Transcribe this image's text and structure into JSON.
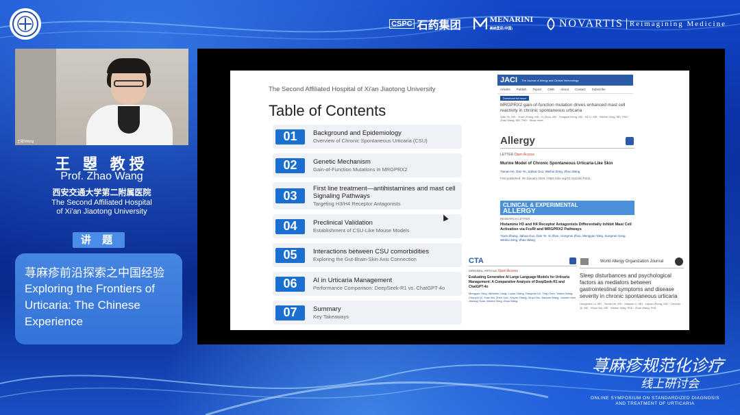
{
  "sponsors": {
    "cspc_mark": "CSPC",
    "cspc_name": "石药集团",
    "menarini": "MENARINI",
    "menarini_sub": "美纳里尼(中国)",
    "novartis": "NOVARTIS",
    "novartis_tagline": "Reimagining Medicine"
  },
  "speaker": {
    "name_cn": "王 曌 教授",
    "name_en": "Prof.  Zhao Wang",
    "hospital_cn": "西安交通大学第二附属医院",
    "hospital_en_line1": "The Second Affiliated Hospital",
    "hospital_en_line2": "of Xi'an Jiaotong University",
    "video_caption": "王曌/Wang"
  },
  "topic": {
    "badge": "讲 题",
    "title_cn": "荨麻疹前沿探索之中国经验",
    "title_en": "Exploring the Frontiers of Urticaria: The Chinese Experience"
  },
  "slide": {
    "hospital": "The Second Affiliated Hospital of Xi'an Jiaotong University",
    "title": "Table of Contents",
    "items": [
      {
        "num": "01",
        "head": "Background and Epidemiology",
        "sub": "Overview of Chronic Spontaneous Urticaria (CSU)"
      },
      {
        "num": "02",
        "head": "Genetic Mechanism",
        "sub": "Gain-of-Function Mutations in MRGPRX2"
      },
      {
        "num": "03",
        "head": "First line treatment—antihistamines and mast cell Signaling Pathways",
        "sub": "Targeting H3/H4 Receptor Antagonists"
      },
      {
        "num": "04",
        "head": "Preclinical Validation",
        "sub": "Establishment of CSU-Like Mouse Models"
      },
      {
        "num": "05",
        "head": "Interactions between CSU comorbidities",
        "sub": "Exploring the Gut-Brain-Skin Axis Connection"
      },
      {
        "num": "06",
        "head": "AI in Urticaria Management",
        "sub": "Performance Comparison: DeepSeek-R1 vs. ChatGPT-4o"
      },
      {
        "num": "07",
        "head": "Summary",
        "sub": "Key Takeaways"
      }
    ],
    "jaci": {
      "logo": "JACI",
      "logo_sub": "The Journal of Allergy and Clinical Immunology",
      "nav": [
        "Articles",
        "Publish",
        "Topics",
        "CME",
        "About",
        "Contact",
        "Subscribe"
      ],
      "download": "Download full issue",
      "title": "MRGPRX2 gain-of-function mutation drives enhanced mast cell reactivity in chronic spontaneous urticaria",
      "authors": "Qian Ye, MD · Yuxin Zhang, MD · Xi Zhou, MD · Sungwei Deng, MD · Ke Li, MD · Weihui Zeng, MD, PhD · Zhao Wang, MD, PhD · Show more"
    },
    "allergy": {
      "logo": "Allergy",
      "letter": "LETTER",
      "open_access": "Open Access",
      "title": "Murine Model of Chronic Spontaneous Urticaria-Like Skin",
      "authors": "Tianan He, Dan Ye, Jiahua Guo, Weihui Zeng, Zhao Wang",
      "published": "First published: 09 January 2026  |  https://doi.org/10.1111/all.70211"
    },
    "cea": {
      "line1": "CLINICAL & EXPERIMENTAL",
      "line2": "ALLERGY",
      "type": "RESEARCH LETTER",
      "title": "Histamine H3 and H4 Receptor Antagonists Differentially Inhibit Mast Cell Activation via FcεRI and MRGPRX2 Pathways",
      "authors": "Yuxin Zhang, Jiahua Guo, Dan Ye, Xi Zhou, Hongmei Zhou, Mengyao Yang, Sungmei Gong, Weihui Zeng, Zhao Wang"
    },
    "cta": {
      "logo": "CTA",
      "type": "ORIGINAL ARTICLE",
      "open_access": "Open Access",
      "title": "Evaluating Generative AI Large Language Models for Urticaria Management: A Comparative Analysis of DeepSeek-R1 and ChatGPT-4o",
      "authors": "Mengyao Yang, Weichen Liang, Luyao Zhang, Hongmei Liu, Ting Chen, Yawen Wang, Chunzhi Qi, Yuan Ma, Zhen Gao, Xinyue Zhang, Xinyu Niu, Jiaxuan Wang, Junwen Han, Jinming Yuan, Weihui Zeng, Zhao Wang"
    },
    "wao": {
      "logo": "World Allergy Organization Journal",
      "title": "Sleep disturbances and psychological factors as mediators between gastrointestinal symptoms and disease severity in chronic spontaneous urticaria",
      "authors": "Hongzhen Lu, MD · Yumei He, MD · Xiaoyan Li, MD · Lujuan Zheng, MD · Chunzhi Qi, MD · Xinyu Niu, MD · Weihui Zeng, PhD · Zhao Wang, PhD"
    }
  },
  "brand": {
    "cn_line1": "荨麻疹规范化诊疗",
    "cn_line2": "线上研讨会",
    "en_line1": "ONLINE SYMPOSIUM ON STANDARDIZED DIAGNOSIS",
    "en_line2": "AND TREATMENT OF URTICARIA"
  },
  "colors": {
    "background": "#0a2c9a",
    "toc_number": "#1a6fd1",
    "topic_box": "#4b8ce8"
  }
}
